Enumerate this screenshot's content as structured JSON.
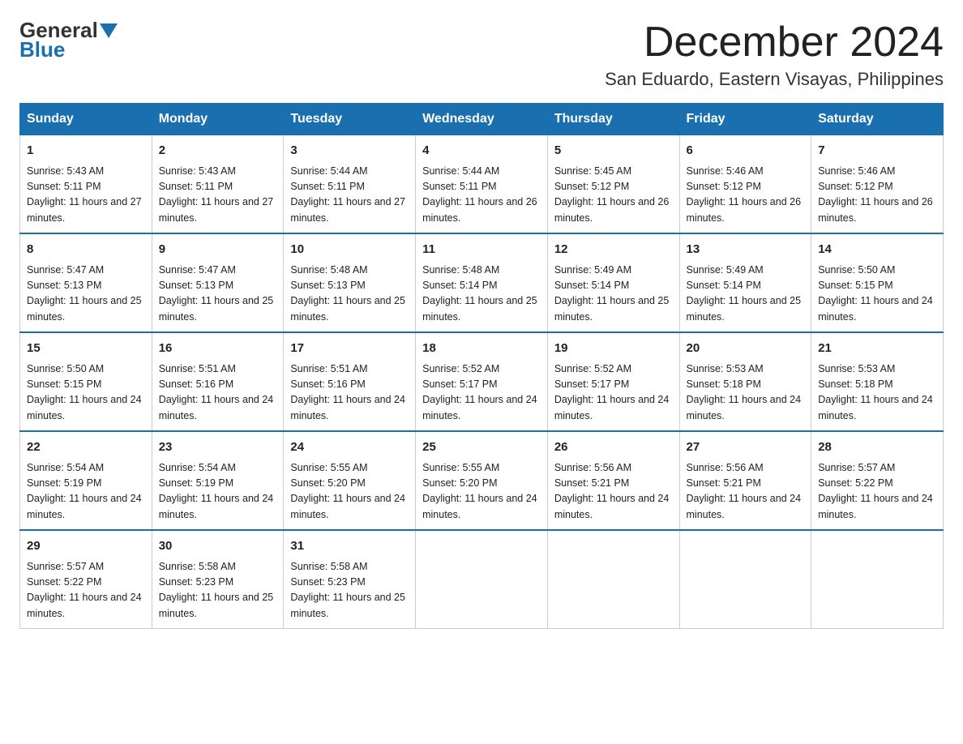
{
  "header": {
    "logo_general": "General",
    "logo_blue": "Blue",
    "month_title": "December 2024",
    "location": "San Eduardo, Eastern Visayas, Philippines"
  },
  "weekdays": [
    "Sunday",
    "Monday",
    "Tuesday",
    "Wednesday",
    "Thursday",
    "Friday",
    "Saturday"
  ],
  "weeks": [
    [
      {
        "day": "1",
        "sunrise": "5:43 AM",
        "sunset": "5:11 PM",
        "daylight": "11 hours and 27 minutes."
      },
      {
        "day": "2",
        "sunrise": "5:43 AM",
        "sunset": "5:11 PM",
        "daylight": "11 hours and 27 minutes."
      },
      {
        "day": "3",
        "sunrise": "5:44 AM",
        "sunset": "5:11 PM",
        "daylight": "11 hours and 27 minutes."
      },
      {
        "day": "4",
        "sunrise": "5:44 AM",
        "sunset": "5:11 PM",
        "daylight": "11 hours and 26 minutes."
      },
      {
        "day": "5",
        "sunrise": "5:45 AM",
        "sunset": "5:12 PM",
        "daylight": "11 hours and 26 minutes."
      },
      {
        "day": "6",
        "sunrise": "5:46 AM",
        "sunset": "5:12 PM",
        "daylight": "11 hours and 26 minutes."
      },
      {
        "day": "7",
        "sunrise": "5:46 AM",
        "sunset": "5:12 PM",
        "daylight": "11 hours and 26 minutes."
      }
    ],
    [
      {
        "day": "8",
        "sunrise": "5:47 AM",
        "sunset": "5:13 PM",
        "daylight": "11 hours and 25 minutes."
      },
      {
        "day": "9",
        "sunrise": "5:47 AM",
        "sunset": "5:13 PM",
        "daylight": "11 hours and 25 minutes."
      },
      {
        "day": "10",
        "sunrise": "5:48 AM",
        "sunset": "5:13 PM",
        "daylight": "11 hours and 25 minutes."
      },
      {
        "day": "11",
        "sunrise": "5:48 AM",
        "sunset": "5:14 PM",
        "daylight": "11 hours and 25 minutes."
      },
      {
        "day": "12",
        "sunrise": "5:49 AM",
        "sunset": "5:14 PM",
        "daylight": "11 hours and 25 minutes."
      },
      {
        "day": "13",
        "sunrise": "5:49 AM",
        "sunset": "5:14 PM",
        "daylight": "11 hours and 25 minutes."
      },
      {
        "day": "14",
        "sunrise": "5:50 AM",
        "sunset": "5:15 PM",
        "daylight": "11 hours and 24 minutes."
      }
    ],
    [
      {
        "day": "15",
        "sunrise": "5:50 AM",
        "sunset": "5:15 PM",
        "daylight": "11 hours and 24 minutes."
      },
      {
        "day": "16",
        "sunrise": "5:51 AM",
        "sunset": "5:16 PM",
        "daylight": "11 hours and 24 minutes."
      },
      {
        "day": "17",
        "sunrise": "5:51 AM",
        "sunset": "5:16 PM",
        "daylight": "11 hours and 24 minutes."
      },
      {
        "day": "18",
        "sunrise": "5:52 AM",
        "sunset": "5:17 PM",
        "daylight": "11 hours and 24 minutes."
      },
      {
        "day": "19",
        "sunrise": "5:52 AM",
        "sunset": "5:17 PM",
        "daylight": "11 hours and 24 minutes."
      },
      {
        "day": "20",
        "sunrise": "5:53 AM",
        "sunset": "5:18 PM",
        "daylight": "11 hours and 24 minutes."
      },
      {
        "day": "21",
        "sunrise": "5:53 AM",
        "sunset": "5:18 PM",
        "daylight": "11 hours and 24 minutes."
      }
    ],
    [
      {
        "day": "22",
        "sunrise": "5:54 AM",
        "sunset": "5:19 PM",
        "daylight": "11 hours and 24 minutes."
      },
      {
        "day": "23",
        "sunrise": "5:54 AM",
        "sunset": "5:19 PM",
        "daylight": "11 hours and 24 minutes."
      },
      {
        "day": "24",
        "sunrise": "5:55 AM",
        "sunset": "5:20 PM",
        "daylight": "11 hours and 24 minutes."
      },
      {
        "day": "25",
        "sunrise": "5:55 AM",
        "sunset": "5:20 PM",
        "daylight": "11 hours and 24 minutes."
      },
      {
        "day": "26",
        "sunrise": "5:56 AM",
        "sunset": "5:21 PM",
        "daylight": "11 hours and 24 minutes."
      },
      {
        "day": "27",
        "sunrise": "5:56 AM",
        "sunset": "5:21 PM",
        "daylight": "11 hours and 24 minutes."
      },
      {
        "day": "28",
        "sunrise": "5:57 AM",
        "sunset": "5:22 PM",
        "daylight": "11 hours and 24 minutes."
      }
    ],
    [
      {
        "day": "29",
        "sunrise": "5:57 AM",
        "sunset": "5:22 PM",
        "daylight": "11 hours and 24 minutes."
      },
      {
        "day": "30",
        "sunrise": "5:58 AM",
        "sunset": "5:23 PM",
        "daylight": "11 hours and 25 minutes."
      },
      {
        "day": "31",
        "sunrise": "5:58 AM",
        "sunset": "5:23 PM",
        "daylight": "11 hours and 25 minutes."
      },
      null,
      null,
      null,
      null
    ]
  ]
}
